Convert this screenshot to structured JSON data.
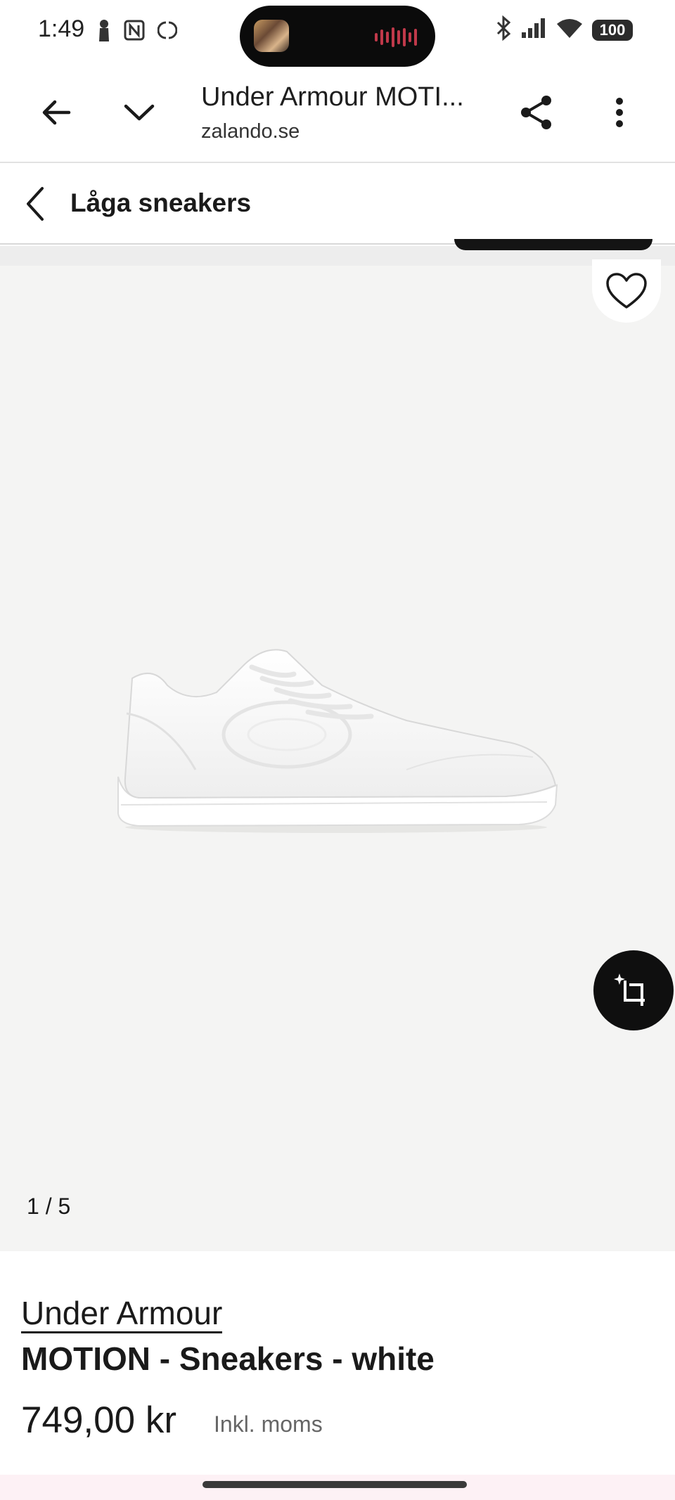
{
  "status_bar": {
    "time": "1:49",
    "left_icons": [
      "person-pin-icon",
      "nfc-icon",
      "sync-icon"
    ],
    "right_icons": [
      "bluetooth-icon",
      "signal-icon",
      "wifi-icon"
    ],
    "battery": "100"
  },
  "browser": {
    "page_title": "Under Armour MOTI...",
    "domain": "zalando.se",
    "icons": [
      "back-arrow-icon",
      "chevron-down-icon",
      "share-icon",
      "more-vert-icon"
    ]
  },
  "category": {
    "title": "Låga sneakers"
  },
  "gallery": {
    "counter": "1 / 5",
    "background_color": "#f4f4f3"
  },
  "product": {
    "brand": "Under Armour",
    "name": "MOTION - Sneakers - white",
    "price": "749,00 kr",
    "tax_note": "Inkl. moms"
  },
  "colors": {
    "text_primary": "#1a1a1a",
    "text_secondary": "#666666",
    "accent_dark": "#0f0f0f"
  }
}
